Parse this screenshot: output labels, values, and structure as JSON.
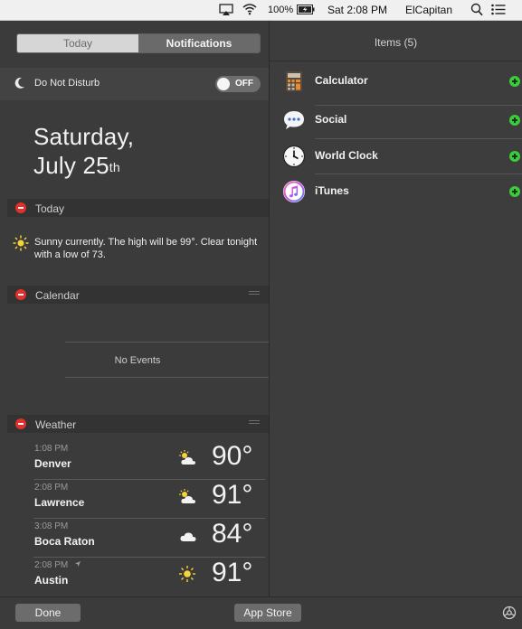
{
  "menubar": {
    "battery": "100%",
    "datetime": "Sat 2:08 PM",
    "user": "ElCapitan",
    "icons": [
      "airplay-icon",
      "wifi-icon",
      "battery-icon",
      "spotlight-search-icon",
      "notification-center-icon"
    ]
  },
  "tabs": {
    "today": "Today",
    "notifications": "Notifications",
    "active": "Notifications"
  },
  "dnd": {
    "label": "Do Not Disturb",
    "state": "OFF"
  },
  "date": {
    "weekday": "Saturday,",
    "month_day": "July 25",
    "suffix": "th"
  },
  "sections": {
    "today": {
      "title": "Today",
      "summary": "Sunny currently. The high will be 99°. Clear tonight with a low of 73."
    },
    "calendar": {
      "title": "Calendar",
      "empty": "No Events"
    },
    "weather": {
      "title": "Weather",
      "rows": [
        {
          "time": "1:08 PM",
          "city": "Denver",
          "temp": "90°",
          "icon": "partly-cloudy-icon"
        },
        {
          "time": "2:08 PM",
          "city": "Lawrence",
          "temp": "91°",
          "icon": "partly-cloudy-icon"
        },
        {
          "time": "3:08 PM",
          "city": "Boca Raton",
          "temp": "84°",
          "icon": "cloud-icon"
        },
        {
          "time": "2:08 PM",
          "city": "Austin",
          "temp": "91°",
          "icon": "sunny-icon"
        }
      ]
    }
  },
  "items": {
    "title": "Items (5)",
    "list": [
      {
        "name": "Calculator",
        "icon": "calculator-icon"
      },
      {
        "name": "Social",
        "icon": "social-icon"
      },
      {
        "name": "World Clock",
        "icon": "world-clock-icon"
      },
      {
        "name": "iTunes",
        "icon": "itunes-icon"
      }
    ]
  },
  "bottom": {
    "done": "Done",
    "app_store": "App Store"
  },
  "colors": {
    "remove": "#e0312b",
    "add": "#3ec93e",
    "sun": "#f5d33a",
    "panel": "#3b3b3b"
  }
}
